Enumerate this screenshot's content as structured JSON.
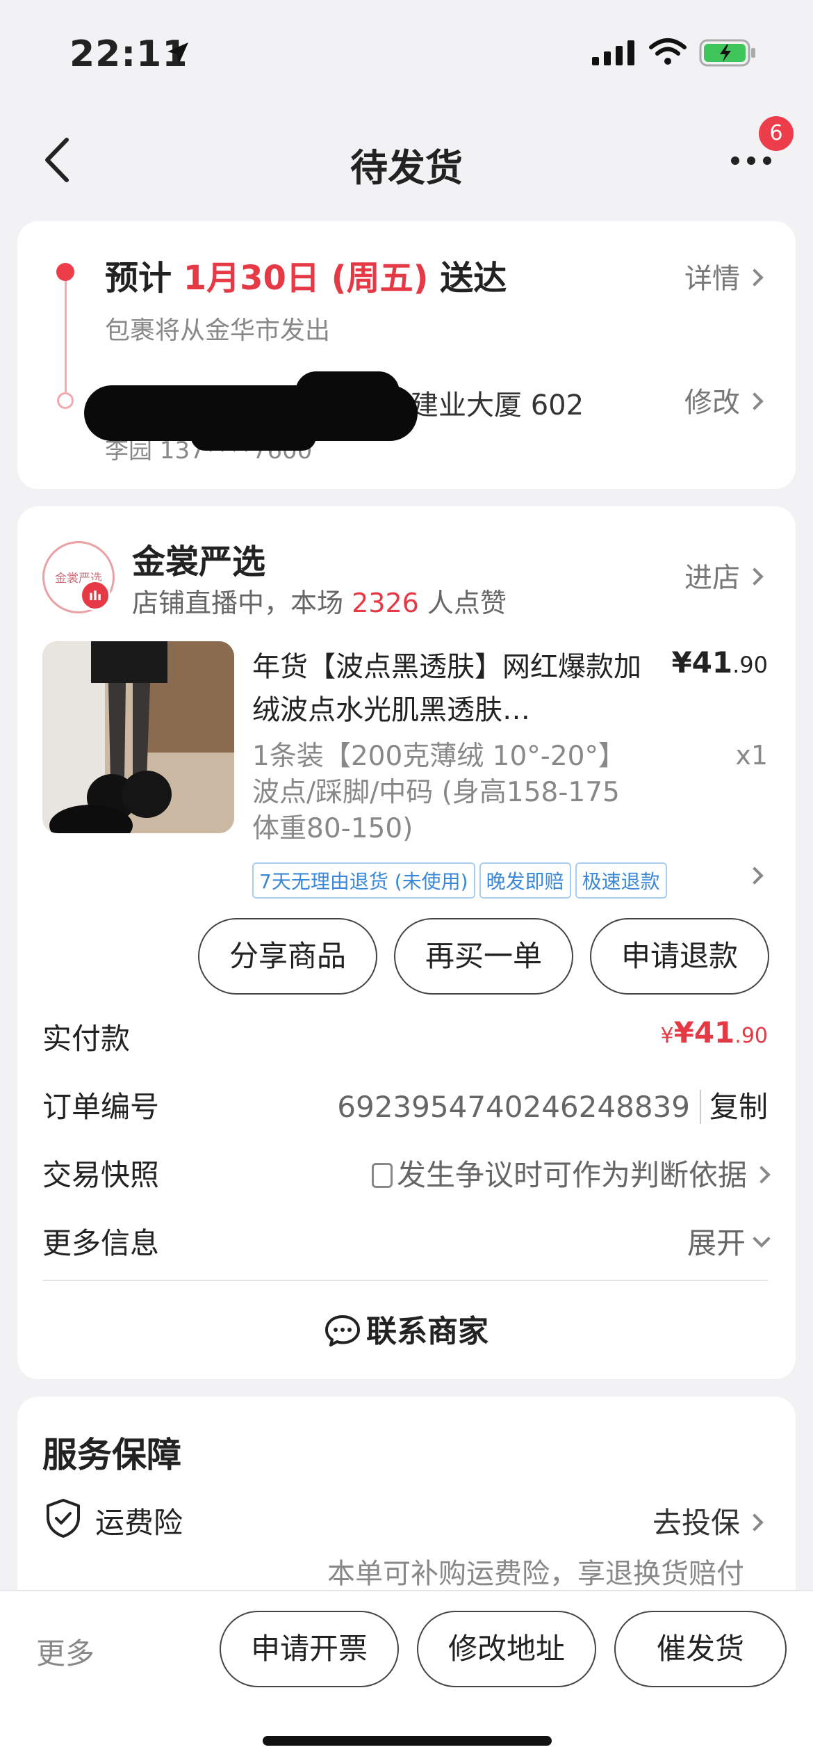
{
  "status_bar": {
    "time": "22:11"
  },
  "nav": {
    "title": "待发货",
    "badge": "6"
  },
  "delivery": {
    "eta_prefix": "预计",
    "eta_date": "1月30日 (周五)",
    "eta_suffix": "送达",
    "ship_from": "包裹将从金华市发出",
    "detail_label": "详情",
    "address": "江西省吉安市吉州区城南建业大厦 602",
    "contact": "李园 137****7600",
    "edit_label": "修改"
  },
  "shop": {
    "logo_text": "金裳严选",
    "name": "金裳严选",
    "live_prefix": "店铺直播中，本场",
    "like_count": "2326",
    "live_suffix": "人点赞",
    "enter_label": "进店"
  },
  "product": {
    "title": "年货【波点黑透肤】网红爆款加绒波点水光肌黑透肤…",
    "price_main": "¥41",
    "price_decimal": ".90",
    "sku": "1条装【200克薄绒 10°-20°】波点/踩脚/中码 (身高158-175 体重80-150)",
    "quantity": "x1",
    "tags": [
      "7天无理由退货 (未使用)",
      "晚发即赔",
      "极速退款"
    ]
  },
  "actions": {
    "share": "分享商品",
    "rebuy": "再买一单",
    "refund": "申请退款"
  },
  "order_info": {
    "paid_label": "实付款",
    "paid_main": "¥41",
    "paid_decimal": ".90",
    "order_no_label": "订单编号",
    "order_no": "6923954740246248839",
    "copy_label": "复制",
    "snapshot_label": "交易快照",
    "snapshot_value": "发生争议时可作为判断依据",
    "more_label": "更多信息",
    "expand_label": "展开",
    "contact_label": "联系商家"
  },
  "service": {
    "title": "服务保障",
    "insurance_name": "运费险",
    "insurance_action": "去投保",
    "insurance_desc": "本单可补购运费险，享退换货赔付"
  },
  "bottom_bar": {
    "more": "更多",
    "invoice": "申请开票",
    "change_address": "修改地址",
    "urge": "催发货"
  },
  "colors": {
    "accent": "#e53945",
    "tag_blue": "#3b88d6",
    "background": "#f2f2f4"
  }
}
